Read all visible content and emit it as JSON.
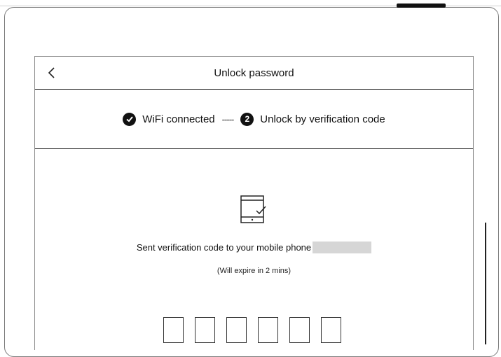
{
  "dialog": {
    "title": "Unlock password",
    "back_icon": "chevron-left-icon"
  },
  "steps": {
    "step1": {
      "label": "WiFi connected",
      "state": "completed",
      "icon": "check-circle-icon"
    },
    "connector": "-----",
    "step2": {
      "number": "2",
      "label": "Unlock by verification code",
      "state": "current"
    }
  },
  "verification": {
    "icon": "phone-check-icon",
    "sent_text": "Sent verification code to your mobile phone",
    "phone_masked": "",
    "expire_text": "(Will expire in 2 mins)",
    "code_length": 6,
    "code_values": [
      "",
      "",
      "",
      "",
      "",
      ""
    ]
  }
}
